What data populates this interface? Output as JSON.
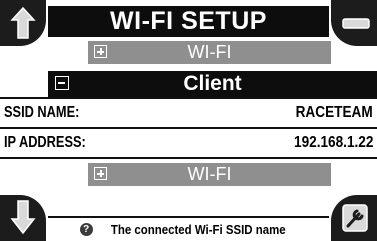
{
  "title": "WI-FI SETUP",
  "sections": {
    "top_wifi_label": "WI-FI",
    "client_label": "Client",
    "bottom_wifi_label": "WI-FI"
  },
  "fields": [
    {
      "key": "SSID NAME:",
      "value": "RACETEAM"
    },
    {
      "key": "IP ADDRESS:",
      "value": "192.168.1.22"
    }
  ],
  "help_text": "The connected Wi-Fi SSID name",
  "icons": {
    "top_left": "arrow-up-icon",
    "top_right": "minus-icon",
    "bottom_left": "arrow-down-icon",
    "bottom_right": "settings-wrench-icon",
    "help": "question-icon",
    "expand": "plus-box-icon",
    "collapse": "minus-box-icon"
  },
  "colors": {
    "title_bg": "#0d0d0d",
    "section_bg": "#8f8f8f",
    "corner_bg": "#1c1c1c"
  }
}
